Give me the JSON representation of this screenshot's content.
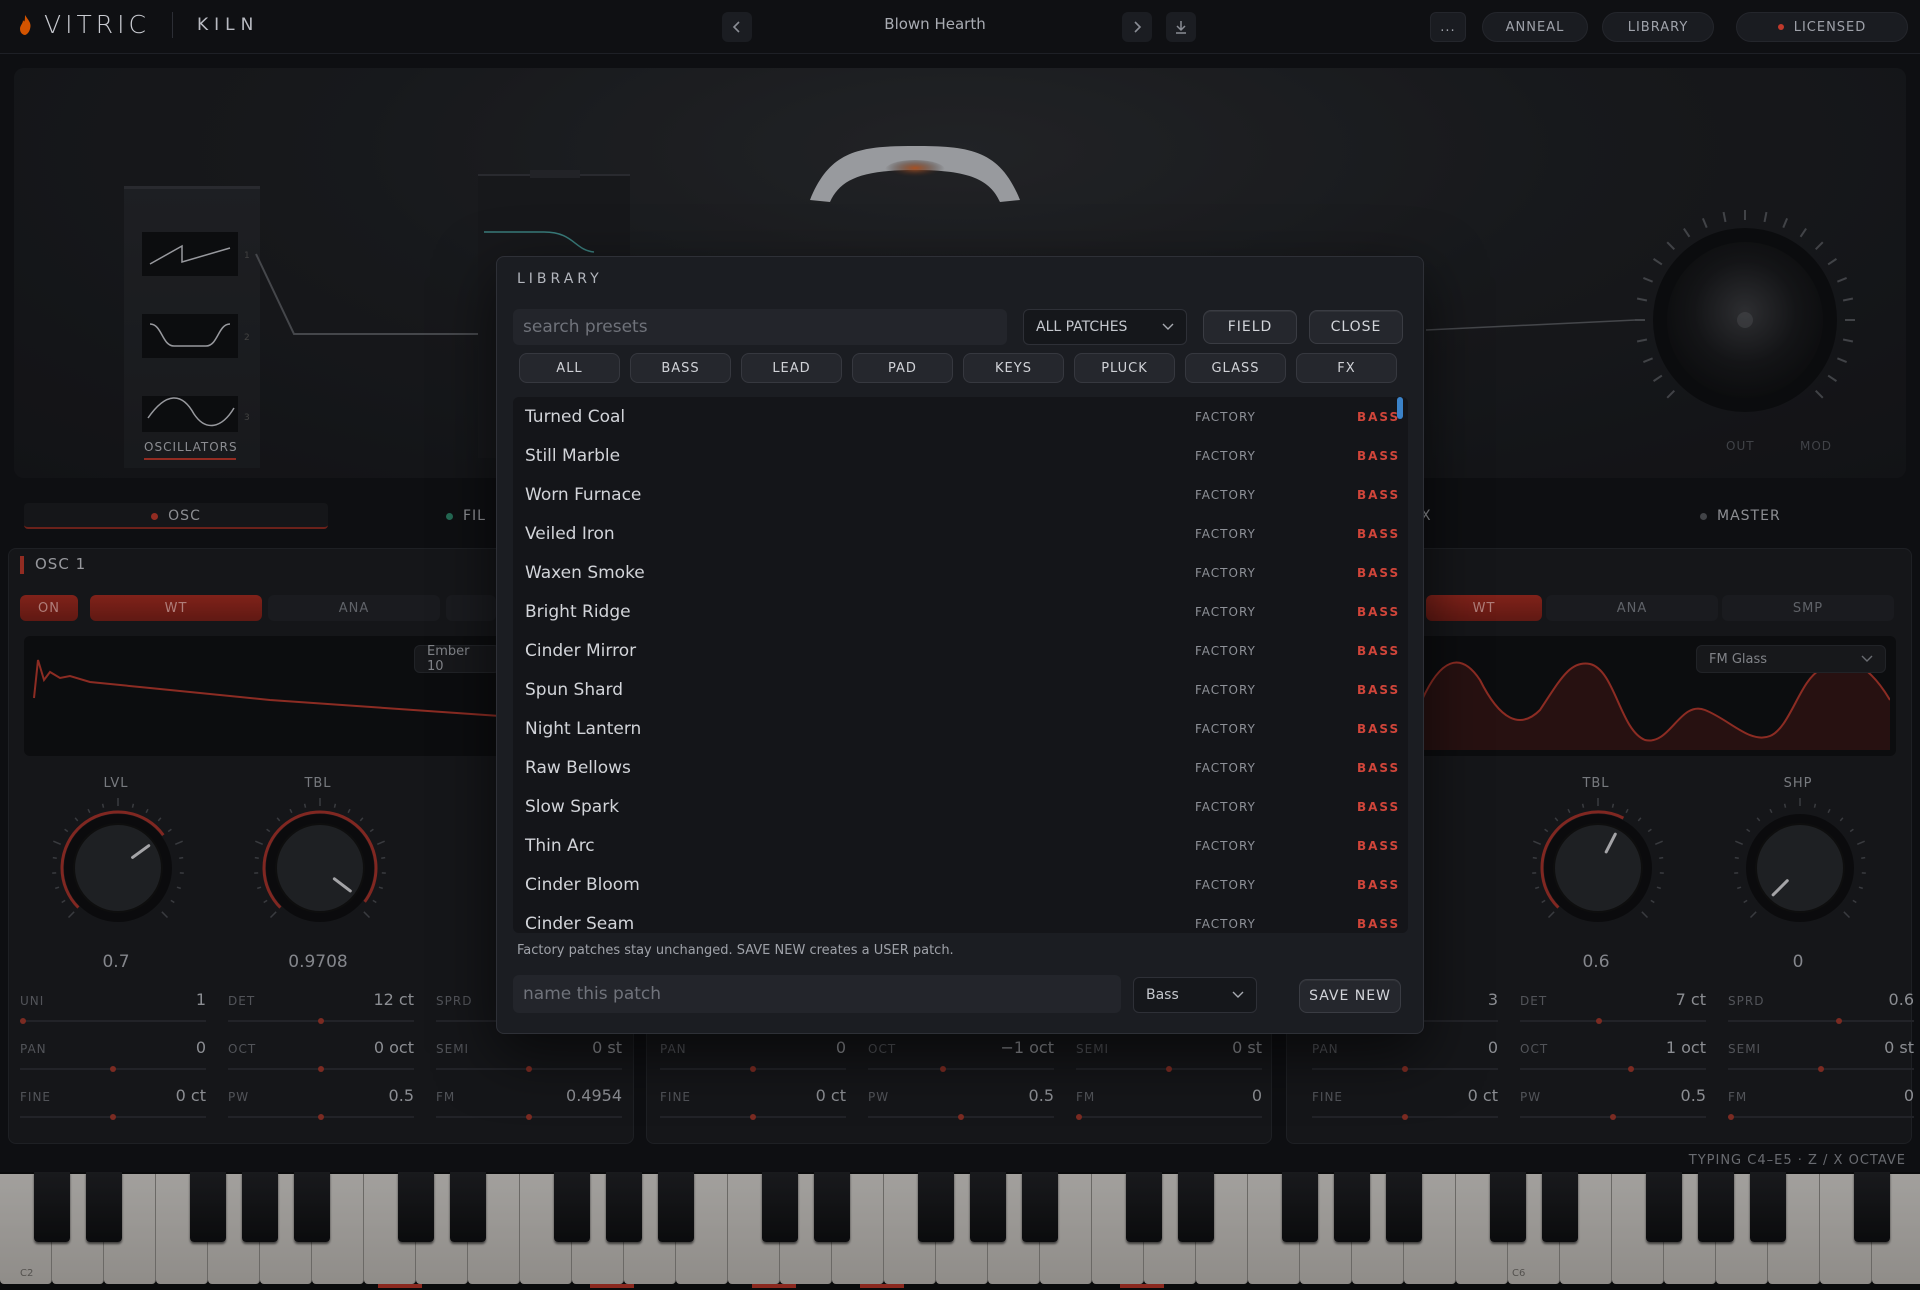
{
  "header": {
    "brand": "VITRIC",
    "product": "KILN",
    "preset_name": "Blown Hearth",
    "more_label": "...",
    "anneal_label": "ANNEAL",
    "library_label": "LIBRARY",
    "licensed_label": "LICENSED"
  },
  "hero": {
    "oscillators_label": "OSCILLATORS",
    "osc_numbers": [
      "1",
      "2",
      "3"
    ],
    "out_label": "OUT",
    "mod_label": "MOD"
  },
  "sections": {
    "osc": "OSC",
    "filter": "FIL",
    "fx": "FX",
    "master": "MASTER"
  },
  "osc1": {
    "title": "OSC 1",
    "on_label": "ON",
    "modes": [
      "WT",
      "ANA"
    ],
    "wavetable": "Ember 10",
    "knobs": [
      {
        "label": "LVL",
        "value": "0.7",
        "level": 0.7
      },
      {
        "label": "TBL",
        "value": "0.9708",
        "level": 0.9708
      }
    ],
    "params": [
      {
        "name": "UNI",
        "value": "1",
        "pos": 0.0
      },
      {
        "name": "DET",
        "value": "12 ct",
        "pos": 0.5
      },
      {
        "name": "SPRD",
        "value": "",
        "pos": 0.5
      },
      {
        "name": "PAN",
        "value": "0",
        "pos": 0.5
      },
      {
        "name": "OCT",
        "value": "0 oct",
        "pos": 0.5
      },
      {
        "name": "SEMI",
        "value": "0 st",
        "pos": 0.5
      },
      {
        "name": "FINE",
        "value": "0 ct",
        "pos": 0.5
      },
      {
        "name": "PW",
        "value": "0.5",
        "pos": 0.5
      },
      {
        "name": "FM",
        "value": "0.4954",
        "pos": 0.5
      }
    ]
  },
  "osc2": {
    "params": [
      {
        "name": "PAN",
        "value": "0",
        "pos": 0.5
      },
      {
        "name": "OCT",
        "value": "−1 oct",
        "pos": 0.4
      },
      {
        "name": "SEMI",
        "value": "0 st",
        "pos": 0.5
      },
      {
        "name": "FINE",
        "value": "0 ct",
        "pos": 0.5
      },
      {
        "name": "PW",
        "value": "0.5",
        "pos": 0.5
      },
      {
        "name": "FM",
        "value": "0",
        "pos": 0.0
      }
    ]
  },
  "osc3": {
    "modes": [
      "WT",
      "ANA",
      "SMP"
    ],
    "wavetable": "FM Glass",
    "knobs": [
      {
        "label": "TBL",
        "value": "0.6",
        "level": 0.6
      },
      {
        "label": "SHP",
        "value": "0",
        "level": 0.0
      }
    ],
    "params": [
      {
        "name": "",
        "value": "3",
        "pos": 0.5
      },
      {
        "name": "DET",
        "value": "7 ct",
        "pos": 0.42
      },
      {
        "name": "SPRD",
        "value": "0.6",
        "pos": 0.6
      },
      {
        "name": "PAN",
        "value": "0",
        "pos": 0.5
      },
      {
        "name": "OCT",
        "value": "1 oct",
        "pos": 0.6
      },
      {
        "name": "SEMI",
        "value": "0 st",
        "pos": 0.5
      },
      {
        "name": "FINE",
        "value": "0 ct",
        "pos": 0.5
      },
      {
        "name": "PW",
        "value": "0.5",
        "pos": 0.5
      },
      {
        "name": "FM",
        "value": "0",
        "pos": 0.0
      }
    ]
  },
  "keyboard": {
    "hint": "TYPING C4–E5 · Z / X OCTAVE",
    "c2_label": "C2",
    "c6_label": "C6"
  },
  "library": {
    "title": "LIBRARY",
    "search_placeholder": "search presets",
    "filter_value": "ALL PATCHES",
    "field_label": "FIELD",
    "close_label": "CLOSE",
    "categories": [
      "ALL",
      "BASS",
      "LEAD",
      "PAD",
      "KEYS",
      "PLUCK",
      "GLASS",
      "FX"
    ],
    "presets": [
      {
        "name": "Turned Coal",
        "source": "FACTORY",
        "category": "BASS"
      },
      {
        "name": "Still Marble",
        "source": "FACTORY",
        "category": "BASS"
      },
      {
        "name": "Worn Furnace",
        "source": "FACTORY",
        "category": "BASS"
      },
      {
        "name": "Veiled Iron",
        "source": "FACTORY",
        "category": "BASS"
      },
      {
        "name": "Waxen Smoke",
        "source": "FACTORY",
        "category": "BASS"
      },
      {
        "name": "Bright Ridge",
        "source": "FACTORY",
        "category": "BASS"
      },
      {
        "name": "Cinder Mirror",
        "source": "FACTORY",
        "category": "BASS"
      },
      {
        "name": "Spun Shard",
        "source": "FACTORY",
        "category": "BASS"
      },
      {
        "name": "Night Lantern",
        "source": "FACTORY",
        "category": "BASS"
      },
      {
        "name": "Raw Bellows",
        "source": "FACTORY",
        "category": "BASS"
      },
      {
        "name": "Slow Spark",
        "source": "FACTORY",
        "category": "BASS"
      },
      {
        "name": "Thin Arc",
        "source": "FACTORY",
        "category": "BASS"
      },
      {
        "name": "Cinder Bloom",
        "source": "FACTORY",
        "category": "BASS"
      },
      {
        "name": "Cinder Seam",
        "source": "FACTORY",
        "category": "BASS"
      }
    ],
    "note": "Factory patches stay unchanged. SAVE NEW creates a USER patch.",
    "name_placeholder": "name this patch",
    "save_category": "Bass",
    "save_label": "SAVE NEW"
  },
  "colors": {
    "accent": "#c0392b",
    "scroll": "#3b82c8",
    "filter_dot": "#2e8a6e"
  }
}
